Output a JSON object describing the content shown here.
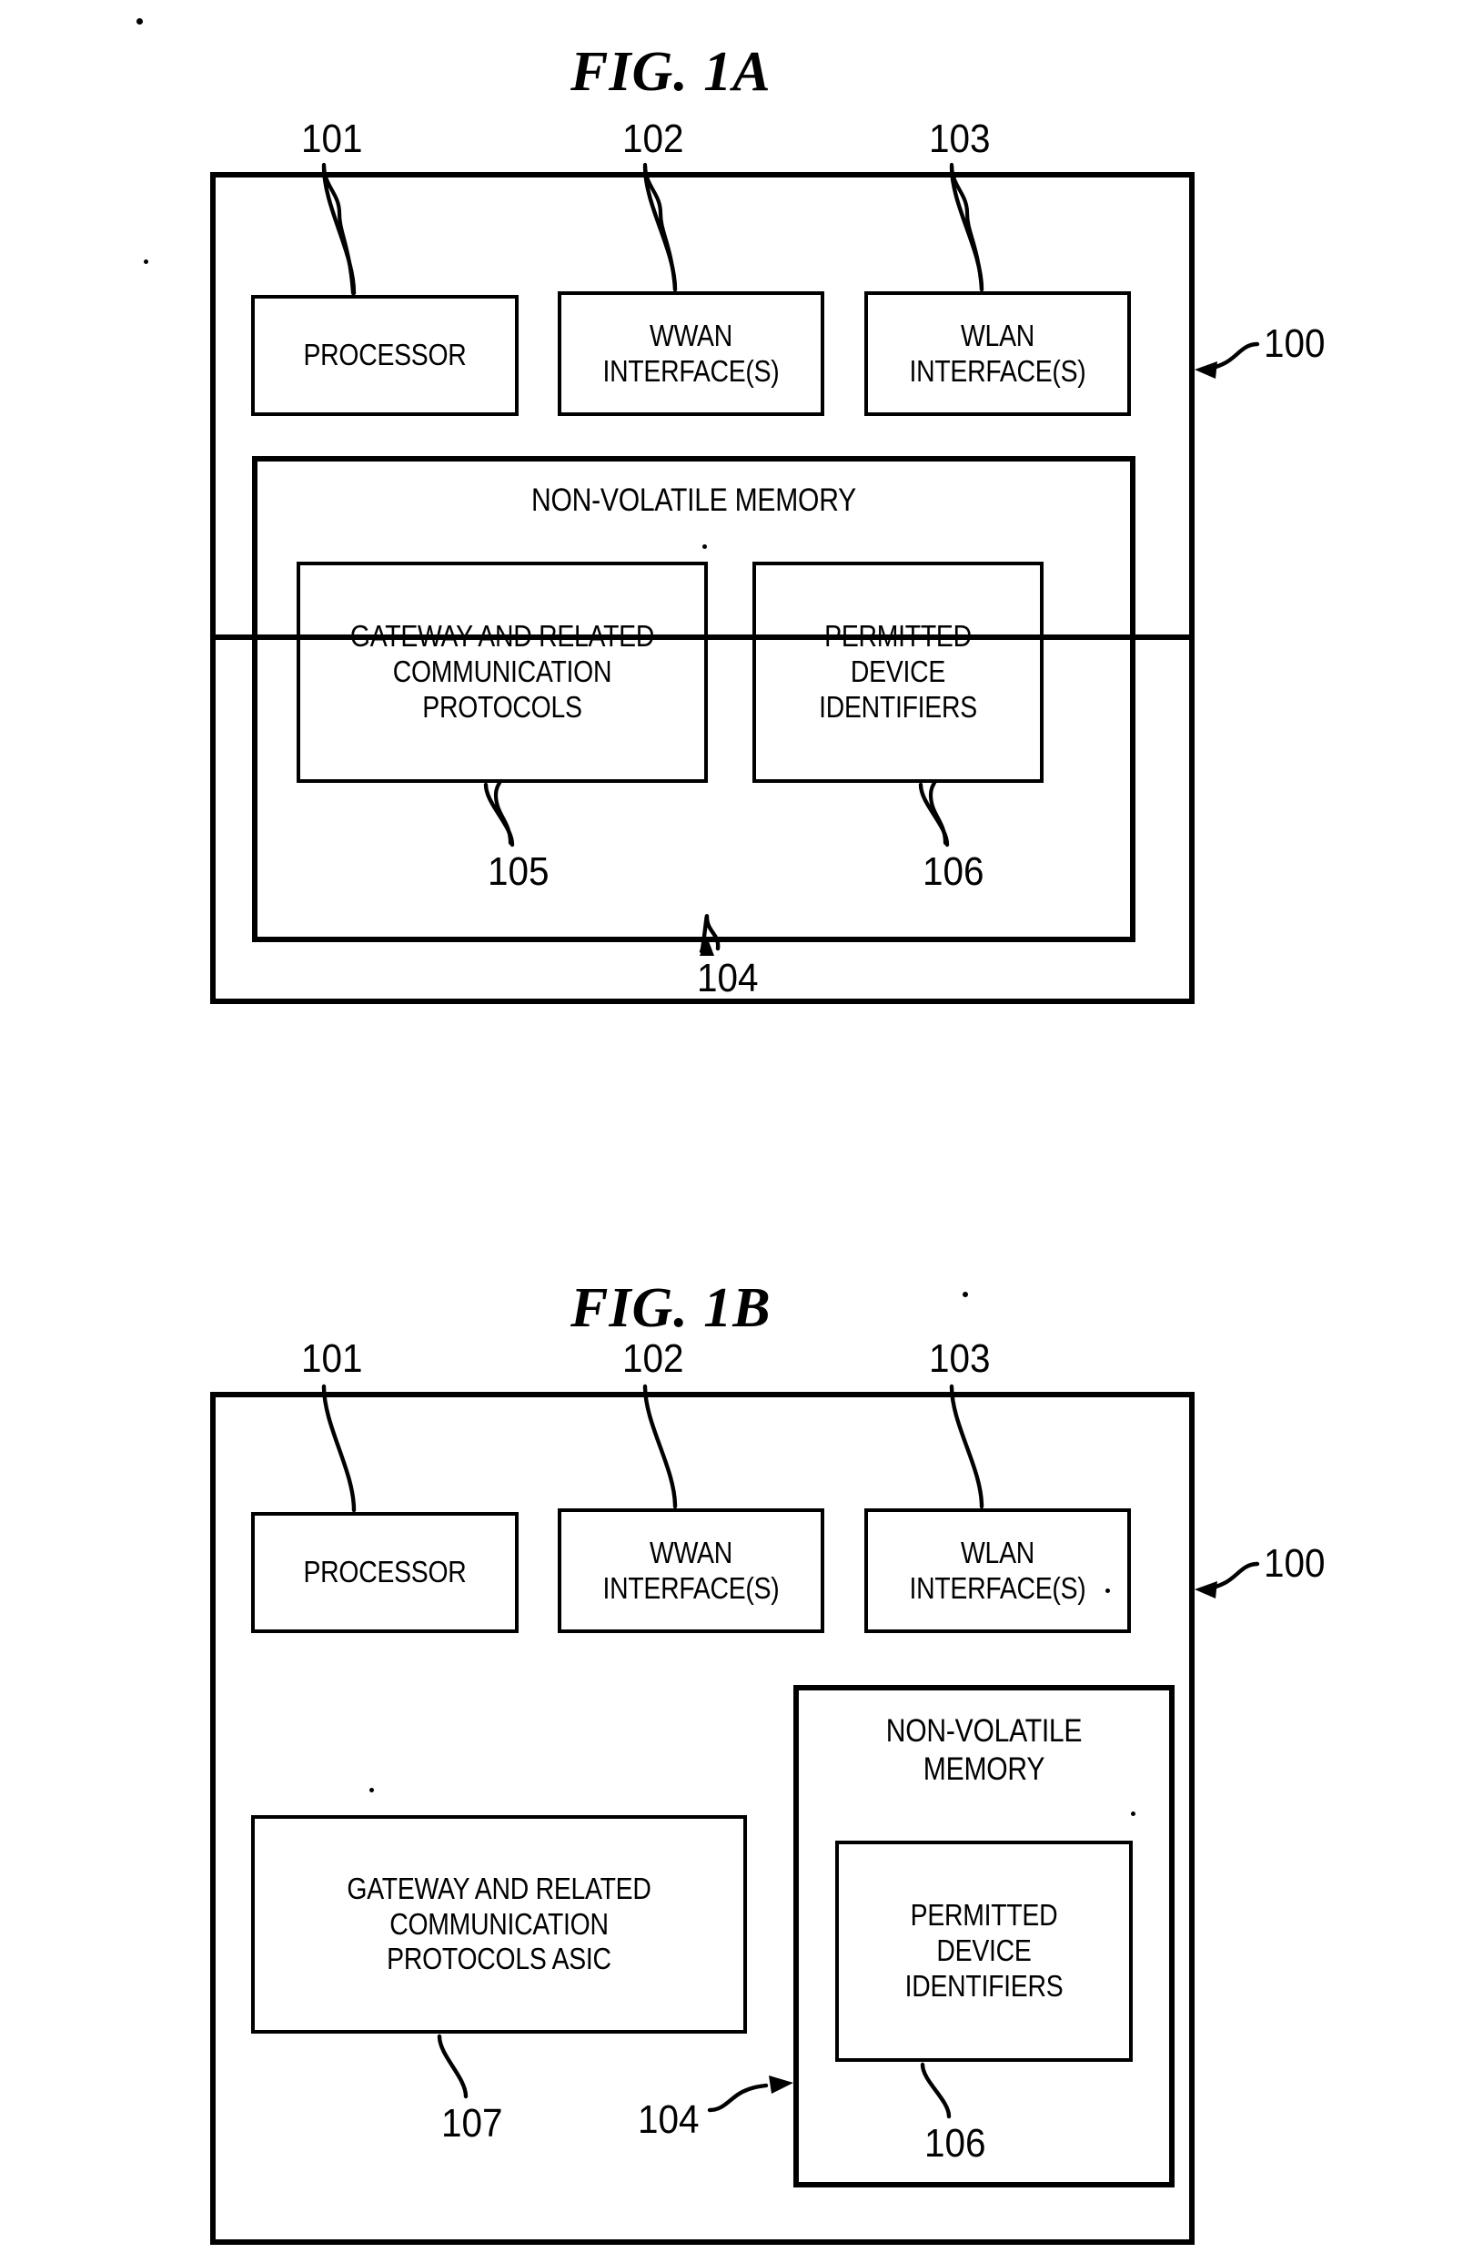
{
  "document": {
    "type": "patent-drawing-sheet",
    "background_color": "#ffffff",
    "ink_color": "#000000"
  },
  "figures": [
    {
      "id": "fig-1a",
      "title": "FIG. 1A",
      "outer_ref": "100",
      "boxes": [
        {
          "name": "processor",
          "label": "PROCESSOR",
          "ref": "101"
        },
        {
          "name": "wwan-interfaces",
          "label": "WWAN\nINTERFACE(S)",
          "ref": "102"
        },
        {
          "name": "wlan-interfaces",
          "label": "WLAN\nINTERFACE(S)",
          "ref": "103"
        },
        {
          "name": "non-volatile-memory",
          "label": "NON-VOLATILE MEMORY",
          "ref": "104"
        },
        {
          "name": "gateway-protocols",
          "label": "GATEWAY AND RELATED\nCOMMUNICATION\nPROTOCOLS",
          "ref": "105"
        },
        {
          "name": "permitted-device-identifiers",
          "label": "PERMITTED\nDEVICE\nIDENTIFIERS",
          "ref": "106"
        }
      ]
    },
    {
      "id": "fig-1b",
      "title": "FIG. 1B",
      "outer_ref": "100",
      "boxes": [
        {
          "name": "processor",
          "label": "PROCESSOR",
          "ref": "101"
        },
        {
          "name": "wwan-interfaces",
          "label": "WWAN\nINTERFACE(S)",
          "ref": "102"
        },
        {
          "name": "wlan-interfaces",
          "label": "WLAN\nINTERFACE(S)",
          "ref": "103"
        },
        {
          "name": "non-volatile-memory",
          "label": "NON-VOLATILE\nMEMORY",
          "ref": "104"
        },
        {
          "name": "gateway-protocols-asic",
          "label": "GATEWAY AND RELATED\nCOMMUNICATION\nPROTOCOLS ASIC",
          "ref": "107"
        },
        {
          "name": "permitted-device-identifiers",
          "label": "PERMITTED\nDEVICE\nIDENTIFIERS",
          "ref": "106"
        }
      ]
    }
  ],
  "fig1a": {
    "title": "FIG. 1A",
    "ref_101": "101",
    "ref_102": "102",
    "ref_103": "103",
    "ref_104": "104",
    "ref_105": "105",
    "ref_106": "106",
    "ref_100": "100",
    "processor_label": "PROCESSOR",
    "wwan_label": "WWAN\nINTERFACE(S)",
    "wlan_label": "WLAN\nINTERFACE(S)",
    "nvm_label": "NON-VOLATILE MEMORY",
    "gateway_label": "GATEWAY AND RELATED\nCOMMUNICATION\nPROTOCOLS",
    "permitted_label": "PERMITTED\nDEVICE\nIDENTIFIERS"
  },
  "fig1b": {
    "title": "FIG. 1B",
    "ref_101": "101",
    "ref_102": "102",
    "ref_103": "103",
    "ref_104": "104",
    "ref_106": "106",
    "ref_107": "107",
    "ref_100": "100",
    "processor_label": "PROCESSOR",
    "wwan_label": "WWAN\nINTERFACE(S)",
    "wlan_label": "WLAN\nINTERFACE(S)",
    "nvm_label": "NON-VOLATILE\nMEMORY",
    "gateway_asic_label": "GATEWAY AND RELATED\nCOMMUNICATION\nPROTOCOLS ASIC",
    "permitted_label": "PERMITTED\nDEVICE\nIDENTIFIERS"
  }
}
